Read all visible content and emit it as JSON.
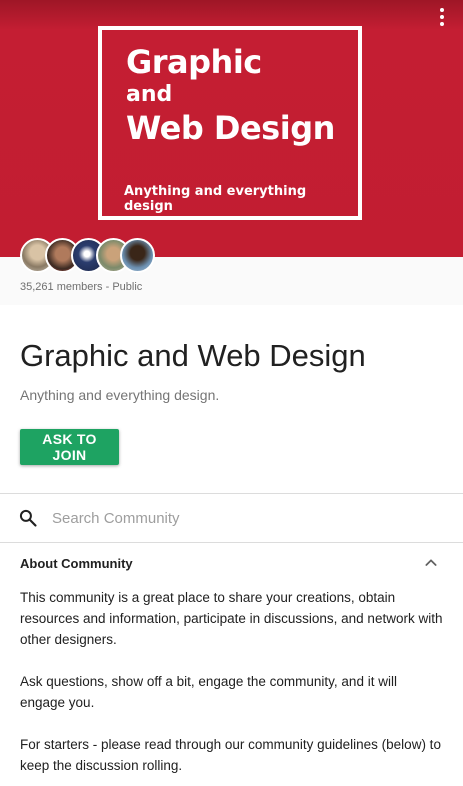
{
  "header": {
    "logo": {
      "line1": "Graphic",
      "line2": "and",
      "line3": "Web Design",
      "tagline": "Anything and everything design"
    },
    "brand_color": "#c21d31",
    "menu_icon": "more-vert-icon"
  },
  "group": {
    "members_text": "35,261 members - Public",
    "name": "Graphic and Web Design",
    "tagline": "Anything and everything design.",
    "join_label": "ASK TO JOIN",
    "join_color": "#1ea362"
  },
  "search": {
    "placeholder": "Search Community",
    "icon": "search-icon"
  },
  "about": {
    "heading": "About Community",
    "paragraphs": [
      "This community is a great place to share your creations, obtain resources and information, participate in discussions, and network with other designers.",
      "Ask questions, show off a bit, engage the community, and it will engage you.",
      "For starters - please read through our community guidelines (below) to keep the discussion rolling."
    ]
  }
}
